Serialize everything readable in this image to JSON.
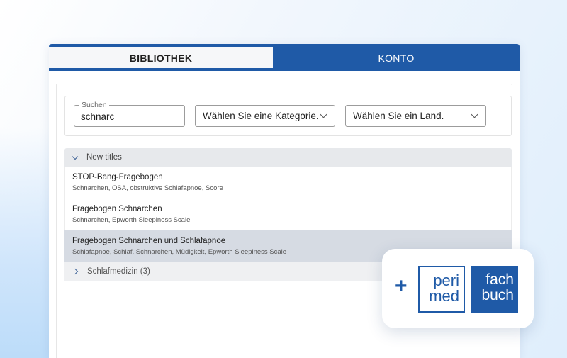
{
  "tabs": [
    {
      "label": "BIBLIOTHEK",
      "active": true
    },
    {
      "label": "KONTO",
      "active": false
    }
  ],
  "search": {
    "label": "Suchen",
    "value": "schnarc"
  },
  "filters": {
    "category_placeholder": "Wählen Sie eine Kategorie.",
    "country_placeholder": "Wählen Sie ein Land."
  },
  "groups": {
    "new_titles": {
      "label": "New titles",
      "expanded": true
    },
    "schlafmedizin": {
      "label": "Schlafmedizin (3)",
      "expanded": false
    }
  },
  "items": [
    {
      "title": "STOP-Bang-Fragebogen",
      "tags": "Schnarchen, OSA, obstruktive Schlafapnoe, Score"
    },
    {
      "title": "Fragebogen Schnarchen",
      "tags": "Schnarchen, Epworth Sleepiness Scale"
    },
    {
      "title": "Fragebogen Schnarchen und Schlafapnoe",
      "tags": "Schlafapnoe, Schlaf, Schnarchen, Müdigkeit, Epworth Sleepiness Scale",
      "selected": true
    }
  ],
  "logos": {
    "plus": "+",
    "perimed_line1": "peri",
    "perimed_line2": "med",
    "fachbuch_line1": "fach",
    "fachbuch_line2": "buch"
  },
  "colors": {
    "brand_blue": "#1f5aa7",
    "selected_row": "#d6dbe3",
    "group_header": "#e7e9ec"
  },
  "icons": {
    "expand_icon": "chevron-down-icon",
    "collapsed_icon": "chevron-right-icon",
    "select_icon": "chevron-down-icon"
  }
}
